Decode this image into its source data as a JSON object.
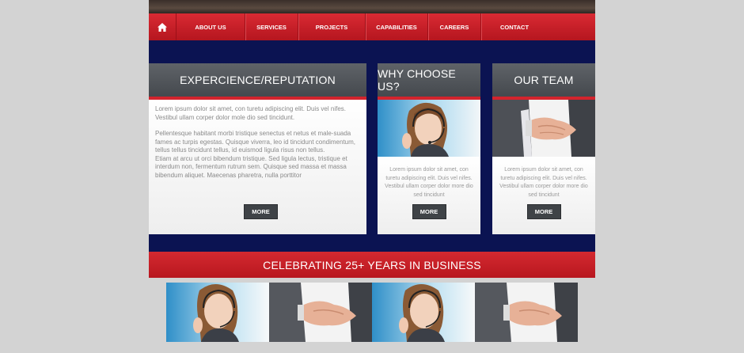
{
  "nav": {
    "items": [
      "ABOUT US",
      "SERVICES",
      "PROJECTS",
      "CAPABILITIES",
      "CAREERS",
      "CONTACT"
    ]
  },
  "panels": {
    "experience": {
      "title": "EXPERCIENCE/REPUTATION",
      "para1": "Lorem ipsum dolor sit amet, con turetu adipiscing elit. Duis vel nifes. Vestibul ullam corper dolor mole dio sed tincidunt.",
      "para2": "Pellentesque habitant morbi tristique senectus et netus et male-suada fames ac turpis egestas. Quisque viverra, leo id tincidunt condimentum, tellus tellus tincidunt tellus, id euismod ligula risus non tellus.",
      "para3": "Etiam at arcu ut orci bibendum tristique. Sed ligula lectus, tristique et interdum non, fermentum rutrum sem. Quisque sed massa et massa bibendum aliquet. Maecenas pharetra, nulla porttitor",
      "more": "MORE"
    },
    "why": {
      "title": "WHY CHOOSE US?",
      "text": "Lorem ipsum dolor sit amet, con turetu adipiscing elit. Duis vel nifes. Vestibul ullam corper dolor more dio sed tincidunt",
      "more": "MORE"
    },
    "team": {
      "title": "OUR TEAM",
      "text": "Lorem ipsum dolor sit amet, con turetu adipiscing elit. Duis vel nifes. Vestibul ullam corper dolor more dio sed tincidunt",
      "more": "MORE"
    }
  },
  "banner": {
    "text": "CELEBRATING 25+ YEARS IN BUSINESS"
  },
  "colors": {
    "nav_red": "#c8202a",
    "navy_band": "#0b1352",
    "panel_head": "#55595e"
  }
}
